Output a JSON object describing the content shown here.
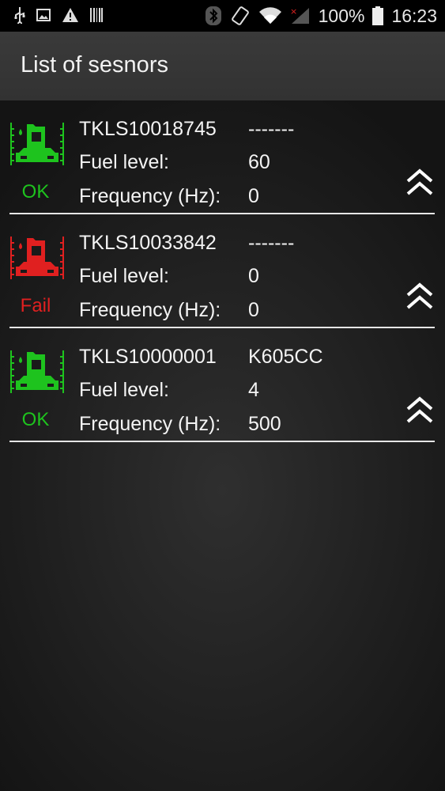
{
  "statusbar": {
    "battery_text": "100%",
    "time": "16:23"
  },
  "header": {
    "title": "List of sesnors"
  },
  "sensors": [
    {
      "id": "TKLS10018745",
      "plate": "-------",
      "fuel_label": "Fuel level:",
      "fuel_value": "60",
      "freq_label": "Frequency (Hz):",
      "freq_value": "0",
      "status": "OK",
      "status_color": "#1ec31e"
    },
    {
      "id": "TKLS10033842",
      "plate": "-------",
      "fuel_label": "Fuel level:",
      "fuel_value": "0",
      "freq_label": "Frequency (Hz):",
      "freq_value": "0",
      "status": "Fail",
      "status_color": "#e02020"
    },
    {
      "id": "TKLS10000001",
      "plate": "K605CC",
      "fuel_label": "Fuel level:",
      "fuel_value": "4",
      "freq_label": "Frequency (Hz):",
      "freq_value": "500",
      "status": "OK",
      "status_color": "#1ec31e"
    }
  ]
}
